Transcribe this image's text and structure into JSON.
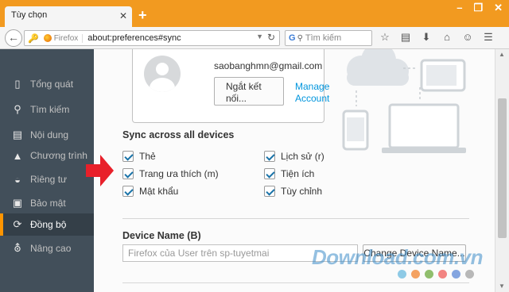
{
  "tab": {
    "title": "Tùy chọn"
  },
  "window": {
    "minimize": "–",
    "restore": "❐",
    "close": "✕"
  },
  "navbar": {
    "identity_label": "Firefox",
    "url": "about:preferences#sync",
    "search_placeholder": "Tìm kiếm"
  },
  "sidebar": {
    "items": [
      {
        "label": "Tổng quát",
        "icon": "window-icon"
      },
      {
        "label": "Tìm kiếm",
        "icon": "search-icon"
      },
      {
        "label": "Nội dung",
        "icon": "document-icon"
      },
      {
        "label": "Chương trình",
        "icon": "rocket-icon"
      },
      {
        "label": "Riêng tư",
        "icon": "mask-icon"
      },
      {
        "label": "Bảo mật",
        "icon": "lock-icon"
      },
      {
        "label": "Đồng bộ",
        "icon": "sync-icon"
      },
      {
        "label": "Nâng cao",
        "icon": "wizard-hat-icon"
      }
    ],
    "active_index": 6
  },
  "account": {
    "email": "saobanghmn@gmail.com",
    "disconnect_line1": "Ngắt kết",
    "disconnect_line2": "nối...",
    "manage_line1": "Manage",
    "manage_line2": "Account"
  },
  "sync": {
    "heading": "Sync across all devices",
    "options": [
      {
        "label": "Thẻ",
        "checked": true
      },
      {
        "label": "Trang ưa thích (m)",
        "checked": true
      },
      {
        "label": "Mật khẩu",
        "checked": true
      },
      {
        "label": "Lịch sử (r)",
        "checked": true
      },
      {
        "label": "Tiện ích",
        "checked": true
      },
      {
        "label": "Tùy chỉnh",
        "checked": true
      }
    ]
  },
  "device": {
    "heading": "Device Name (B)",
    "input_value": "Firefox của User trên sp-tuyetmai",
    "change_button": "Change Device Name..."
  },
  "watermark": {
    "text": "Download.com.vn",
    "dot_colors": [
      "#8ecae6",
      "#f4a261",
      "#90be6d",
      "#f28482",
      "#84a5e0",
      "#b8b8b8"
    ]
  },
  "colors": {
    "titlebar": "#f29a20",
    "sidebar": "#424f5a",
    "accent": "#ff9500",
    "link": "#0095dd"
  }
}
